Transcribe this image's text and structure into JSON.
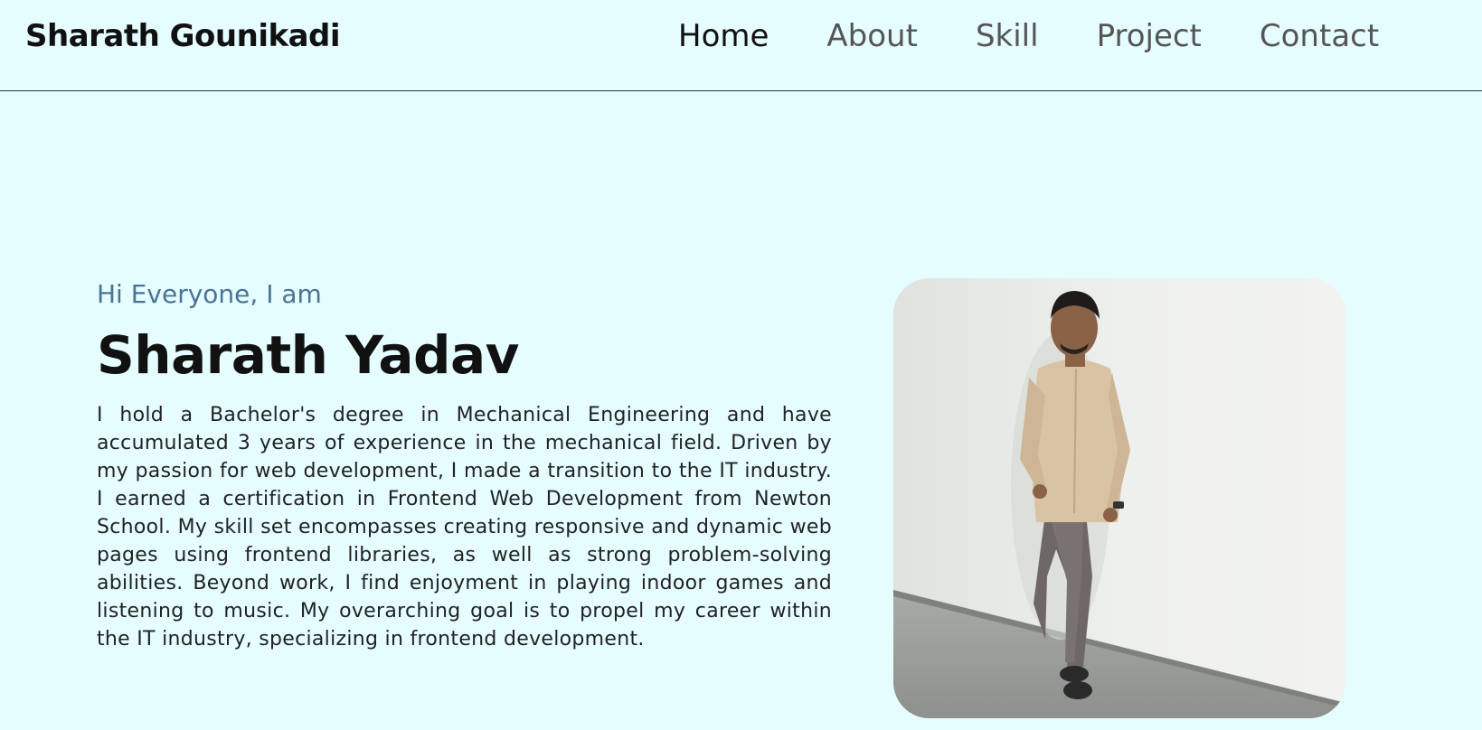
{
  "header": {
    "brand": "Sharath Gounikadi",
    "nav": [
      {
        "label": "Home",
        "active": true
      },
      {
        "label": "About",
        "active": false
      },
      {
        "label": "Skill",
        "active": false
      },
      {
        "label": "Project",
        "active": false
      },
      {
        "label": "Contact",
        "active": false
      }
    ]
  },
  "hero": {
    "greeting": "Hi Everyone, I am",
    "name": "Sharath Yadav",
    "bio": "I hold a Bachelor's degree in Mechanical Engineering and have accumulated 3 years of experience in the mechanical field. Driven by my passion for web development, I made a transition to the IT industry. I earned a certification in Frontend Web Development from Newton School. My skill set encompasses creating responsive and dynamic web pages using frontend libraries, as well as strong problem-solving abilities. Beyond work, I find enjoyment in playing indoor games and listening to music. My overarching goal is to propel my career within the IT industry, specializing in frontend development."
  },
  "colors": {
    "background": "#e6fdff",
    "greeting": "#4a7494",
    "nav_inactive": "#555555",
    "nav_active": "#111111"
  }
}
